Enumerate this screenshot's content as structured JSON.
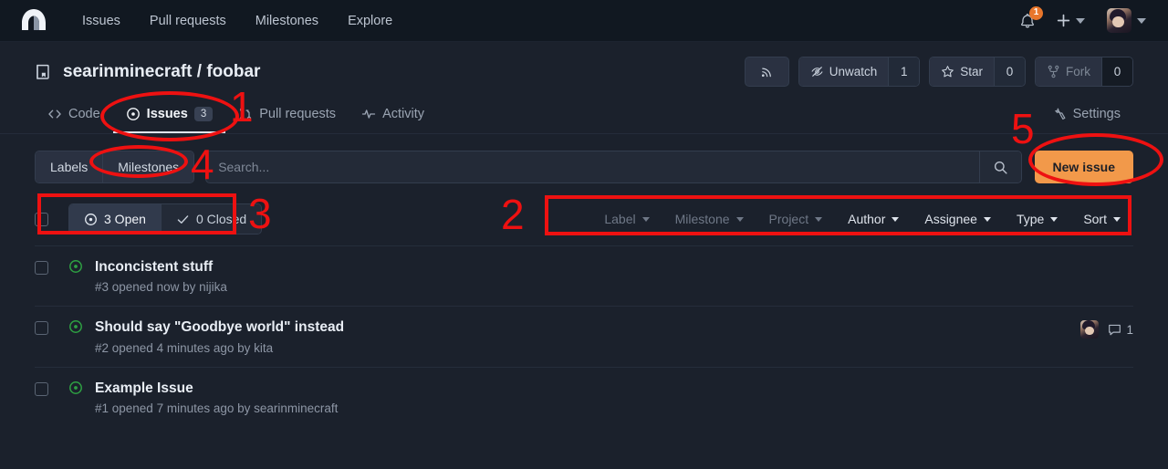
{
  "navbar": {
    "logo_icon": "forgejo-logo-icon",
    "links": [
      {
        "label": "Issues"
      },
      {
        "label": "Pull requests"
      },
      {
        "label": "Milestones"
      },
      {
        "label": "Explore"
      }
    ],
    "notifications": {
      "icon": "bell-icon",
      "count": "1"
    },
    "create_new": {
      "icon": "plus-icon"
    },
    "user_menu": {
      "icon": "avatar"
    }
  },
  "repo": {
    "icon": "repo-book-icon",
    "title": "searinminecraft / foobar",
    "actions": {
      "rss": {
        "icon": "rss-icon"
      },
      "watch": {
        "icon": "eye-slash-icon",
        "label": "Unwatch",
        "count": "1"
      },
      "star": {
        "icon": "star-icon",
        "label": "Star",
        "count": "0"
      },
      "fork": {
        "icon": "fork-icon",
        "label": "Fork",
        "count": "0"
      }
    },
    "tabs": [
      {
        "label": "Code",
        "icon": "code-icon",
        "active": false,
        "dim": true
      },
      {
        "label": "Issues",
        "icon": "issue-opened-icon",
        "active": true,
        "badge": "3"
      },
      {
        "label": "Pull requests",
        "icon": "git-pull-request-icon",
        "active": false
      },
      {
        "label": "Activity",
        "icon": "pulse-icon",
        "active": false
      }
    ],
    "settings_tab": {
      "label": "Settings",
      "icon": "wrench-icon"
    }
  },
  "toolbar": {
    "labels_button": "Labels",
    "milestones_button": "Milestones",
    "search_placeholder": "Search...",
    "search_value": "",
    "search_icon": "search-icon",
    "new_issue_button": "New issue"
  },
  "state_filter": {
    "open": {
      "label": "3 Open",
      "icon": "issue-opened-icon",
      "active": true
    },
    "closed": {
      "label": "0 Closed",
      "icon": "check-icon",
      "active": false
    }
  },
  "filters": [
    {
      "label": "Label",
      "dim": true
    },
    {
      "label": "Milestone",
      "dim": true
    },
    {
      "label": "Project",
      "dim": true
    },
    {
      "label": "Author",
      "dim": false
    },
    {
      "label": "Assignee",
      "dim": false
    },
    {
      "label": "Type",
      "dim": false
    },
    {
      "label": "Sort",
      "dim": false
    }
  ],
  "issues": [
    {
      "title": "Inconcistent stuff",
      "meta": "#3 opened now by nijika",
      "state_icon": "issue-opened-icon",
      "has_assignee": false,
      "comments": ""
    },
    {
      "title": "Should say \"Goodbye world\" instead",
      "meta": "#2 opened 4 minutes ago by kita",
      "state_icon": "issue-opened-icon",
      "has_assignee": true,
      "comments": "1"
    },
    {
      "title": "Example Issue",
      "meta": "#1 opened 7 minutes ago by searinminecraft",
      "state_icon": "issue-opened-icon",
      "has_assignee": false,
      "comments": ""
    }
  ],
  "annotations": [
    {
      "number": "1"
    },
    {
      "number": "2"
    },
    {
      "number": "3"
    },
    {
      "number": "4"
    },
    {
      "number": "5"
    }
  ],
  "colors": {
    "page_bg": "#1b212c",
    "navbar_bg": "#111821",
    "accent_orange": "#f2994a",
    "badge_orange": "#e8762b",
    "issue_open_green": "#2ea043",
    "annotation_red": "#ee1111"
  }
}
